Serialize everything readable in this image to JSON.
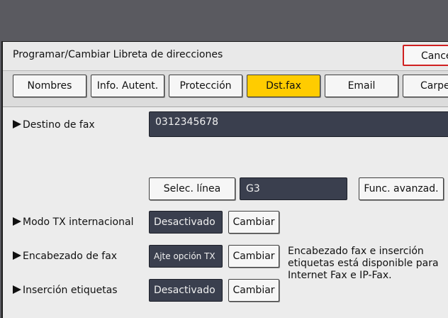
{
  "header": {
    "title": "Programar/Cambiar Libreta de direcciones",
    "cancel_label": "Cancel"
  },
  "tabs": [
    {
      "label": "Nombres",
      "active": false
    },
    {
      "label": "Info. Autent.",
      "active": false
    },
    {
      "label": "Protección",
      "active": false
    },
    {
      "label": "Dst.fax",
      "active": true
    },
    {
      "label": "Email",
      "active": false
    },
    {
      "label": "Carpe",
      "active": false
    }
  ],
  "fax_destination": {
    "label": "Destino de fax",
    "value": "0312345678"
  },
  "line": {
    "select_label": "Selec. línea",
    "value": "G3",
    "advanced_label": "Func. avanzad."
  },
  "intl_tx_mode": {
    "label": "Modo TX internacional",
    "value": "Desactivado",
    "change_label": "Cambiar"
  },
  "fax_header": {
    "label": "Encabezado de fax",
    "value": "Ajte opción TX",
    "change_label": "Cambiar"
  },
  "label_insertion": {
    "label": "Inserción etiquetas",
    "value": "Desactivado",
    "change_label": "Cambiar"
  },
  "note": "Encabezado fax e inserción etiquetas está disponible para Internet Fax e IP-Fax.",
  "colors": {
    "active_tab": "#ffcc00",
    "cancel_border": "#d02020",
    "dark_field": "#3a3f4e"
  }
}
